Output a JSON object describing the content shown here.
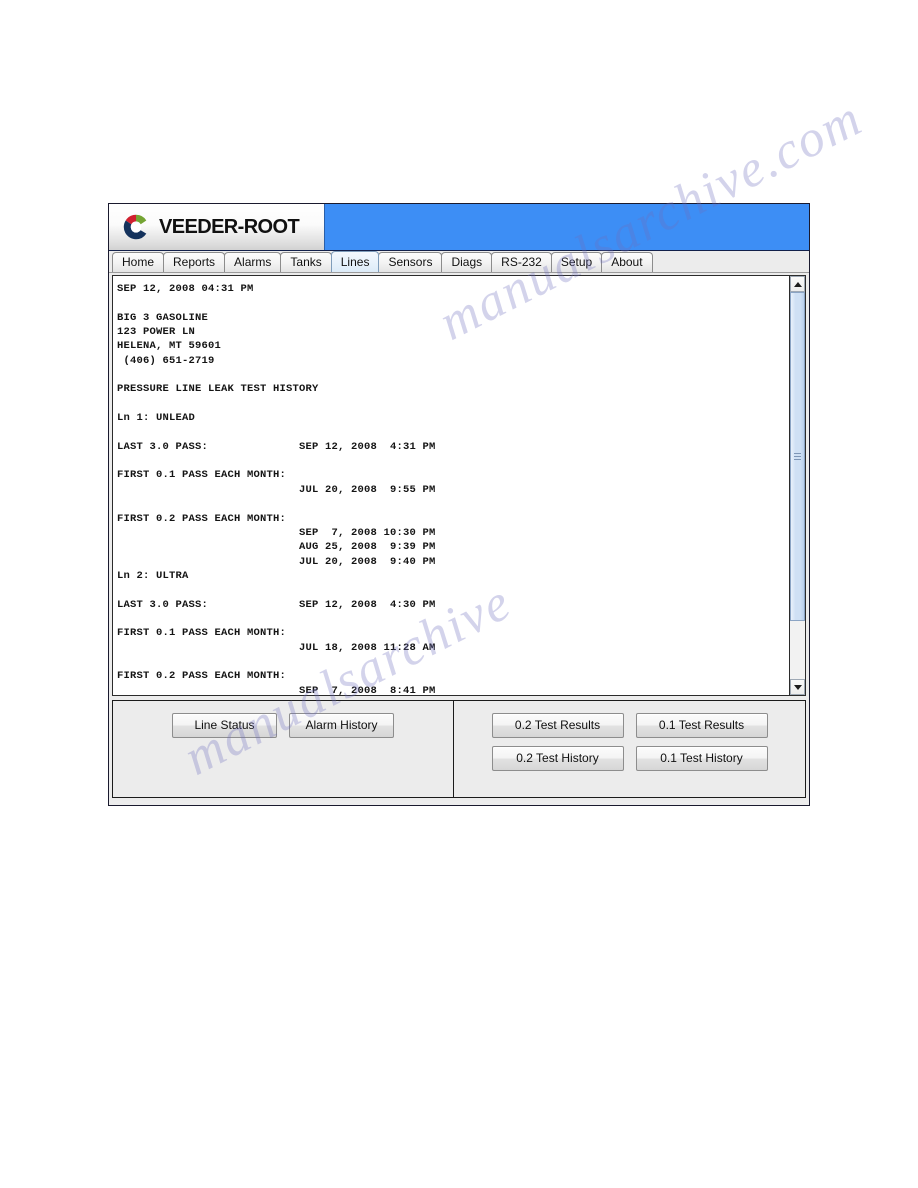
{
  "window": {
    "brand": "VEEDER-ROOT",
    "logo_icon": "veeder-root-swoosh-icon",
    "accent_blue": "#3d8ef5",
    "logo_colors": {
      "red": "#d0202f",
      "green": "#74a433",
      "navy": "#14325c"
    }
  },
  "tabs": [
    {
      "label": "Home",
      "name": "tab-home",
      "active": false
    },
    {
      "label": "Reports",
      "name": "tab-reports",
      "active": false
    },
    {
      "label": "Alarms",
      "name": "tab-alarms",
      "active": false
    },
    {
      "label": "Tanks",
      "name": "tab-tanks",
      "active": false
    },
    {
      "label": "Lines",
      "name": "tab-lines",
      "active": true
    },
    {
      "label": "Sensors",
      "name": "tab-sensors",
      "active": false
    },
    {
      "label": "Diags",
      "name": "tab-diags",
      "active": false
    },
    {
      "label": "RS-232",
      "name": "tab-rs232",
      "active": false
    },
    {
      "label": "Setup",
      "name": "tab-setup",
      "active": false
    },
    {
      "label": "About",
      "name": "tab-about",
      "active": false
    }
  ],
  "report": {
    "timestamp": "SEP 12, 2008 04:31 PM",
    "site": {
      "name": "BIG 3 GASOLINE",
      "street": "123 POWER LN",
      "city_state_zip": "HELENA, MT 59601",
      "phone": "(406) 651-2719"
    },
    "title": "PRESSURE LINE LEAK TEST HISTORY",
    "lines": [
      {
        "header": "Ln 1: UNLEAD",
        "last_3_0_pass_label": "LAST 3.0 PASS:",
        "last_3_0_pass_value": "SEP 12, 2008  4:31 PM",
        "first_0_1_label": "FIRST 0.1 PASS EACH MONTH:",
        "first_0_1_values": [
          "JUL 20, 2008  9:55 PM"
        ],
        "first_0_2_label": "FIRST 0.2 PASS EACH MONTH:",
        "first_0_2_values": [
          "SEP  7, 2008 10:30 PM",
          "AUG 25, 2008  9:39 PM",
          "JUL 20, 2008  9:40 PM"
        ]
      },
      {
        "header": "Ln 2: ULTRA",
        "last_3_0_pass_label": "LAST 3.0 PASS:",
        "last_3_0_pass_value": "SEP 12, 2008  4:30 PM",
        "first_0_1_label": "FIRST 0.1 PASS EACH MONTH:",
        "first_0_1_values": [
          "JUL 18, 2008 11:28 AM"
        ],
        "first_0_2_label": "FIRST 0.2 PASS EACH MONTH:",
        "first_0_2_values": [
          "SEP  7, 2008  8:41 PM"
        ]
      }
    ],
    "body": "SEP 12, 2008 04:31 PM\n\nBIG 3 GASOLINE\n123 POWER LN\nHELENA, MT 59601\n (406) 651-2719\n\nPRESSURE LINE LEAK TEST HISTORY\n\nLn 1: UNLEAD\n\nLAST 3.0 PASS:              SEP 12, 2008  4:31 PM\n\nFIRST 0.1 PASS EACH MONTH:\n                            JUL 20, 2008  9:55 PM\n\nFIRST 0.2 PASS EACH MONTH:\n                            SEP  7, 2008 10:30 PM\n                            AUG 25, 2008  9:39 PM\n                            JUL 20, 2008  9:40 PM\nLn 2: ULTRA\n\nLAST 3.0 PASS:              SEP 12, 2008  4:30 PM\n\nFIRST 0.1 PASS EACH MONTH:\n                            JUL 18, 2008 11:28 AM\n\nFIRST 0.2 PASS EACH MONTH:\n                            SEP  7, 2008  8:41 PM"
  },
  "scrollbar": {
    "up_icon": "scroll-up-arrow-icon",
    "down_icon": "scroll-down-arrow-icon",
    "thumb_position_percent": 0,
    "thumb_size_percent": 85
  },
  "buttons": {
    "left_panel": [
      {
        "label": "Line Status",
        "name": "line-status-button"
      },
      {
        "label": "Alarm History",
        "name": "alarm-history-button"
      }
    ],
    "right_panel_row1": [
      {
        "label": "0.2 Test Results",
        "name": "test-results-02-button"
      },
      {
        "label": "0.1 Test Results",
        "name": "test-results-01-button"
      }
    ],
    "right_panel_row2": [
      {
        "label": "0.2 Test History",
        "name": "test-history-02-button"
      },
      {
        "label": "0.1 Test History",
        "name": "test-history-01-button"
      }
    ]
  },
  "watermark": {
    "line1": "manualsarchive.com",
    "line2": "manualsarchive"
  }
}
